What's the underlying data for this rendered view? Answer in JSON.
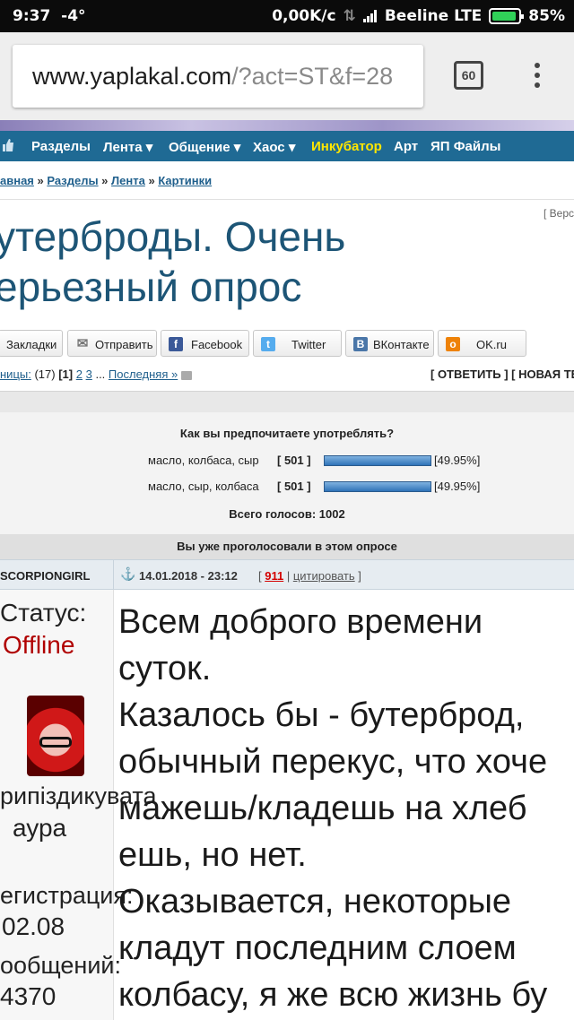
{
  "status_bar": {
    "time": "9:37",
    "temp": "-4°",
    "speed": "0,00K/c",
    "carrier": "Beeline LTE",
    "battery": "85%"
  },
  "browser": {
    "url_main": "www.yaplakal.com",
    "url_rest": "/?act=ST&f=28",
    "tab_count": "60"
  },
  "nav": {
    "items": [
      "Разделы",
      "Лента ▾",
      "Общение ▾",
      "Хаос ▾",
      "Инкубатор",
      "Арт",
      "ЯП Файлы"
    ]
  },
  "breadcrumb": {
    "items": [
      "авная",
      "Разделы",
      "Лента",
      "Картинки"
    ],
    "sep": " » "
  },
  "version_link": "[ Верс",
  "topic": {
    "title_line1": "утерброды. Очень",
    "title_line2": "ерьезный опрос"
  },
  "share": {
    "bookmarks": "Закладки",
    "send": "Отправить",
    "facebook": "Facebook",
    "twitter": "Twitter",
    "vk": "ВКонтакте",
    "ok": "OK.ru"
  },
  "pages": {
    "label": "ницы:",
    "count": "(17)",
    "current": "[1]",
    "p2": "2",
    "p3": "3",
    "dots": "...",
    "last": "Последняя »",
    "reply": "[ ОТВЕТИТЬ ] [ НОВАЯ ТЕ"
  },
  "poll": {
    "question": "Как вы предпочитаете употреблять?",
    "options": [
      {
        "label": "масло, колбаса, сыр",
        "votes": "[ 501 ]",
        "percent": "[49.95%]",
        "fraction": 0.4995
      },
      {
        "label": "масло, сыр, колбаса",
        "votes": "[ 501 ]",
        "percent": "[49.95%]",
        "fraction": 0.4995
      }
    ],
    "total": "Всего голосов: 1002",
    "voted_note": "Вы уже проголосовали в этом опросе"
  },
  "post": {
    "author": "SCORPIONGIRL",
    "date": "14.01.2018 - 23:12",
    "rating": "911",
    "cite": "цитировать",
    "status_label": "Статус:",
    "status_value": "Offline",
    "rank_line1": "рипіздикувата",
    "rank_line2": "аура",
    "reg_label": "егистрация:",
    "reg_value": "02.08",
    "msgs_label": "ообщений:",
    "msgs_value": "4370",
    "lines": [
      "Всем доброго времени",
      "суток.",
      "Казалось бы - бутерброд,",
      "обычный перекус, что хоче",
      "мажешь/кладешь на хлеб",
      "ешь, но нет.",
      "Оказывается, некоторые",
      "кладут последним слоем",
      "колбасу, я же всю жизнь бу"
    ]
  }
}
